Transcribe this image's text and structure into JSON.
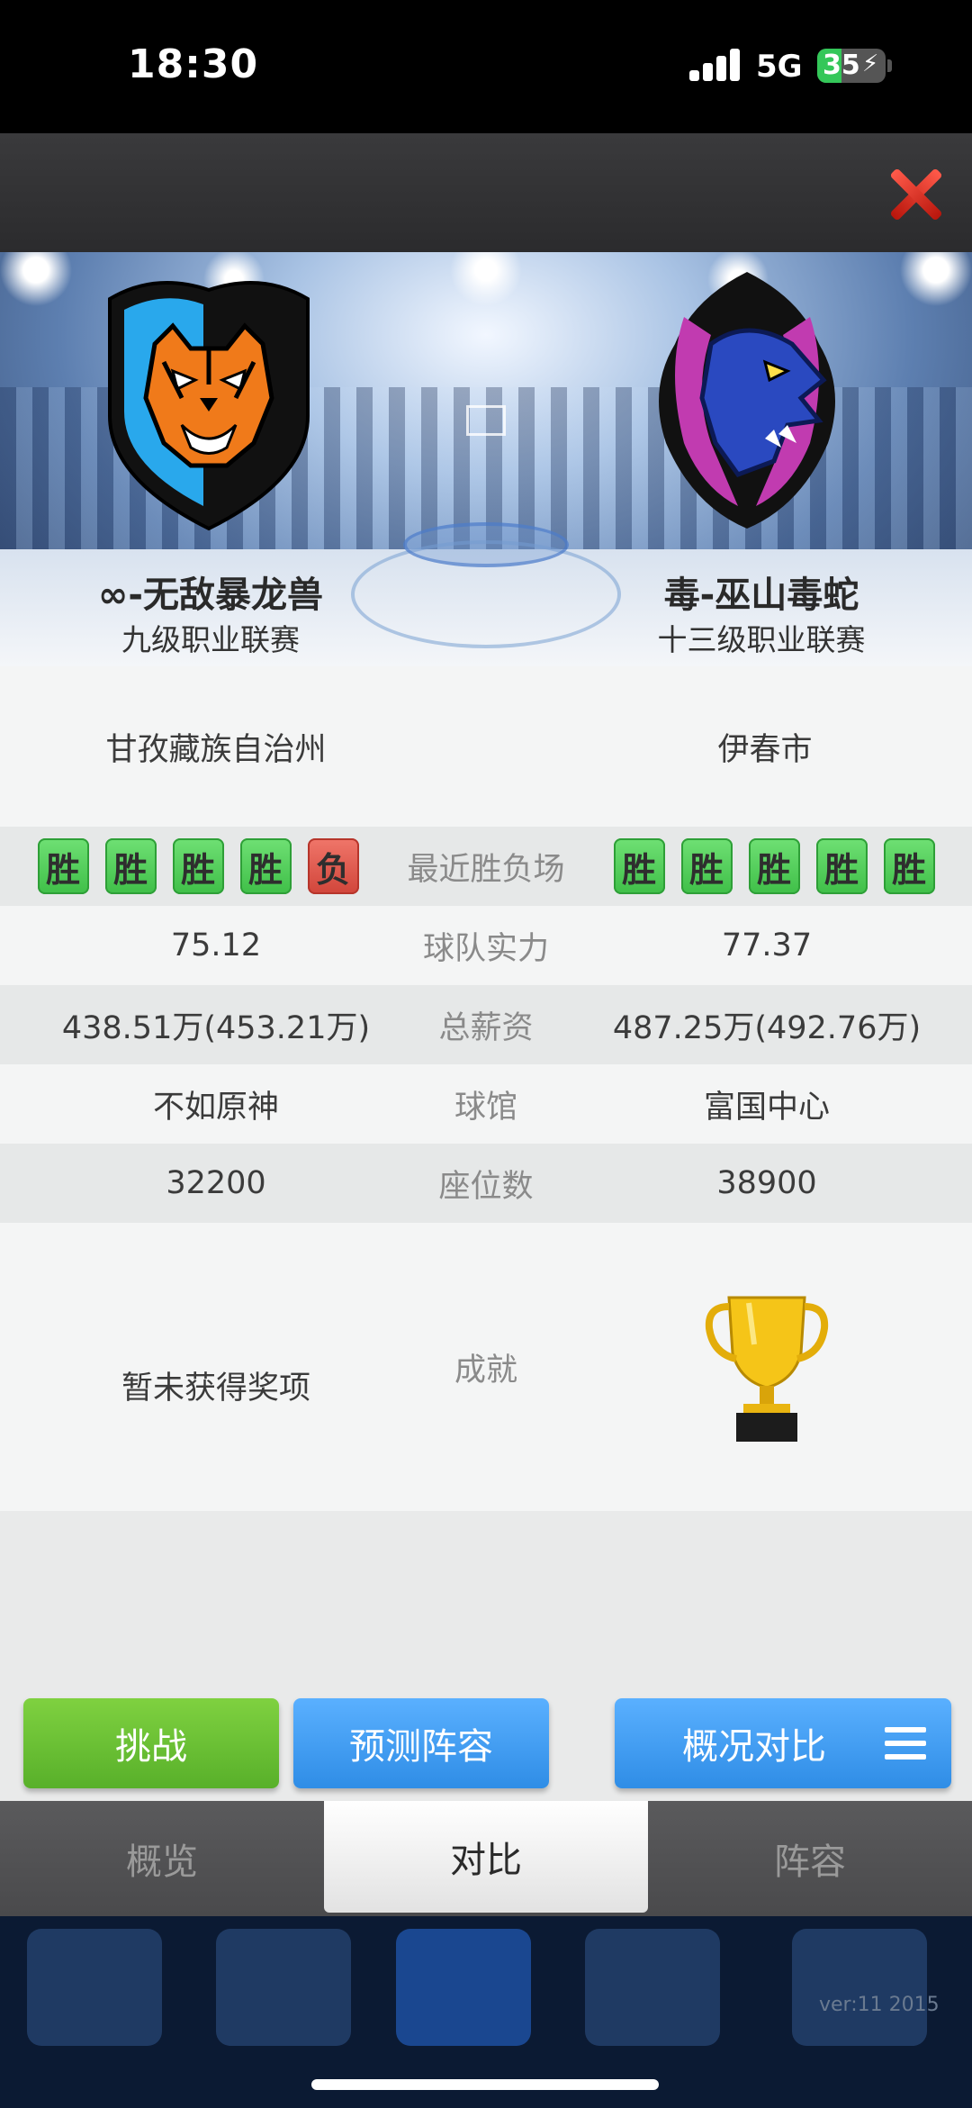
{
  "status_bar": {
    "time": "18:30",
    "network": "5G",
    "battery": "35",
    "battery_level": 0.35
  },
  "header": {
    "close_icon": "close-icon"
  },
  "teams": {
    "left": {
      "name": "∞-无敌暴龙兽",
      "league": "九级职业联赛",
      "logo": "tiger-shield-logo"
    },
    "right": {
      "name": "毒-巫山毒蛇",
      "league": "十三级职业联赛",
      "logo": "dragon-logo"
    }
  },
  "stats": {
    "city": {
      "left": "甘孜藏族自治州",
      "label": "",
      "right": "伊春市"
    },
    "recent": {
      "label": "最近胜负场",
      "left": [
        "胜",
        "胜",
        "胜",
        "胜",
        "负"
      ],
      "right": [
        "胜",
        "胜",
        "胜",
        "胜",
        "胜"
      ]
    },
    "strength": {
      "left": "75.12",
      "label": "球队实力",
      "right": "77.37"
    },
    "salary": {
      "left": "438.51万(453.21万)",
      "label": "总薪资",
      "right": "487.25万(492.76万)"
    },
    "arena": {
      "left": "不如原神",
      "label": "球馆",
      "right": "富国中心"
    },
    "seats": {
      "left": "32200",
      "label": "座位数",
      "right": "38900"
    },
    "achievements": {
      "left": "暂未获得奖项",
      "label": "成就",
      "right_icon": "trophy-icon"
    }
  },
  "actions": {
    "challenge": "挑战",
    "predict": "预测阵容",
    "compare": "概况对比"
  },
  "tabs": [
    "概览",
    "对比",
    "阵容"
  ],
  "active_tab": 1,
  "footer": {
    "version": "ver:11  2015"
  },
  "colors": {
    "win": "#4cc152",
    "loss": "#dc5145",
    "blue_button": "#3f9cf2",
    "green_button": "#6cc236"
  }
}
